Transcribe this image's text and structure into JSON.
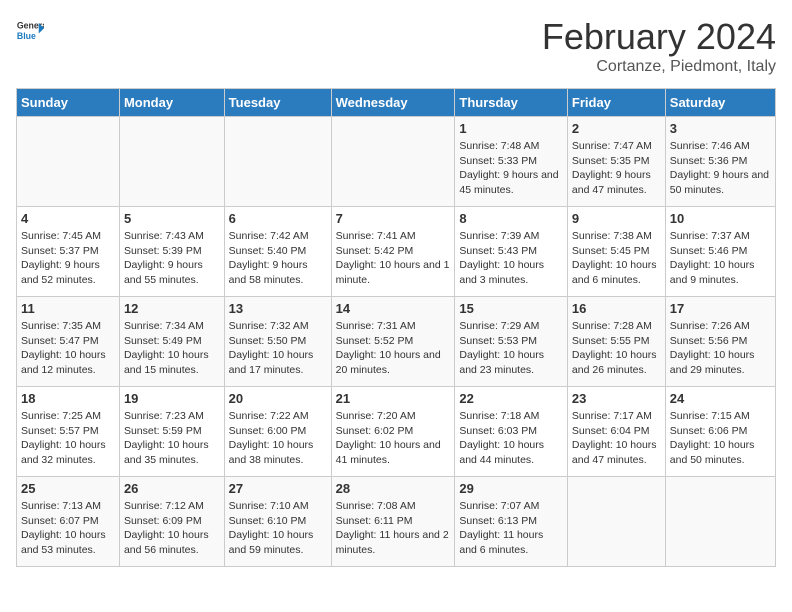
{
  "header": {
    "logo_line1": "General",
    "logo_line2": "Blue",
    "title": "February 2024",
    "subtitle": "Cortanze, Piedmont, Italy"
  },
  "columns": [
    "Sunday",
    "Monday",
    "Tuesday",
    "Wednesday",
    "Thursday",
    "Friday",
    "Saturday"
  ],
  "weeks": [
    {
      "days": [
        {
          "num": "",
          "info": ""
        },
        {
          "num": "",
          "info": ""
        },
        {
          "num": "",
          "info": ""
        },
        {
          "num": "",
          "info": ""
        },
        {
          "num": "1",
          "info": "Sunrise: 7:48 AM\nSunset: 5:33 PM\nDaylight: 9 hours\nand 45 minutes."
        },
        {
          "num": "2",
          "info": "Sunrise: 7:47 AM\nSunset: 5:35 PM\nDaylight: 9 hours\nand 47 minutes."
        },
        {
          "num": "3",
          "info": "Sunrise: 7:46 AM\nSunset: 5:36 PM\nDaylight: 9 hours\nand 50 minutes."
        }
      ]
    },
    {
      "days": [
        {
          "num": "4",
          "info": "Sunrise: 7:45 AM\nSunset: 5:37 PM\nDaylight: 9 hours\nand 52 minutes."
        },
        {
          "num": "5",
          "info": "Sunrise: 7:43 AM\nSunset: 5:39 PM\nDaylight: 9 hours\nand 55 minutes."
        },
        {
          "num": "6",
          "info": "Sunrise: 7:42 AM\nSunset: 5:40 PM\nDaylight: 9 hours\nand 58 minutes."
        },
        {
          "num": "7",
          "info": "Sunrise: 7:41 AM\nSunset: 5:42 PM\nDaylight: 10 hours\nand 1 minute."
        },
        {
          "num": "8",
          "info": "Sunrise: 7:39 AM\nSunset: 5:43 PM\nDaylight: 10 hours\nand 3 minutes."
        },
        {
          "num": "9",
          "info": "Sunrise: 7:38 AM\nSunset: 5:45 PM\nDaylight: 10 hours\nand 6 minutes."
        },
        {
          "num": "10",
          "info": "Sunrise: 7:37 AM\nSunset: 5:46 PM\nDaylight: 10 hours\nand 9 minutes."
        }
      ]
    },
    {
      "days": [
        {
          "num": "11",
          "info": "Sunrise: 7:35 AM\nSunset: 5:47 PM\nDaylight: 10 hours\nand 12 minutes."
        },
        {
          "num": "12",
          "info": "Sunrise: 7:34 AM\nSunset: 5:49 PM\nDaylight: 10 hours\nand 15 minutes."
        },
        {
          "num": "13",
          "info": "Sunrise: 7:32 AM\nSunset: 5:50 PM\nDaylight: 10 hours\nand 17 minutes."
        },
        {
          "num": "14",
          "info": "Sunrise: 7:31 AM\nSunset: 5:52 PM\nDaylight: 10 hours\nand 20 minutes."
        },
        {
          "num": "15",
          "info": "Sunrise: 7:29 AM\nSunset: 5:53 PM\nDaylight: 10 hours\nand 23 minutes."
        },
        {
          "num": "16",
          "info": "Sunrise: 7:28 AM\nSunset: 5:55 PM\nDaylight: 10 hours\nand 26 minutes."
        },
        {
          "num": "17",
          "info": "Sunrise: 7:26 AM\nSunset: 5:56 PM\nDaylight: 10 hours\nand 29 minutes."
        }
      ]
    },
    {
      "days": [
        {
          "num": "18",
          "info": "Sunrise: 7:25 AM\nSunset: 5:57 PM\nDaylight: 10 hours\nand 32 minutes."
        },
        {
          "num": "19",
          "info": "Sunrise: 7:23 AM\nSunset: 5:59 PM\nDaylight: 10 hours\nand 35 minutes."
        },
        {
          "num": "20",
          "info": "Sunrise: 7:22 AM\nSunset: 6:00 PM\nDaylight: 10 hours\nand 38 minutes."
        },
        {
          "num": "21",
          "info": "Sunrise: 7:20 AM\nSunset: 6:02 PM\nDaylight: 10 hours\nand 41 minutes."
        },
        {
          "num": "22",
          "info": "Sunrise: 7:18 AM\nSunset: 6:03 PM\nDaylight: 10 hours\nand 44 minutes."
        },
        {
          "num": "23",
          "info": "Sunrise: 7:17 AM\nSunset: 6:04 PM\nDaylight: 10 hours\nand 47 minutes."
        },
        {
          "num": "24",
          "info": "Sunrise: 7:15 AM\nSunset: 6:06 PM\nDaylight: 10 hours\nand 50 minutes."
        }
      ]
    },
    {
      "days": [
        {
          "num": "25",
          "info": "Sunrise: 7:13 AM\nSunset: 6:07 PM\nDaylight: 10 hours\nand 53 minutes."
        },
        {
          "num": "26",
          "info": "Sunrise: 7:12 AM\nSunset: 6:09 PM\nDaylight: 10 hours\nand 56 minutes."
        },
        {
          "num": "27",
          "info": "Sunrise: 7:10 AM\nSunset: 6:10 PM\nDaylight: 10 hours\nand 59 minutes."
        },
        {
          "num": "28",
          "info": "Sunrise: 7:08 AM\nSunset: 6:11 PM\nDaylight: 11 hours\nand 2 minutes."
        },
        {
          "num": "29",
          "info": "Sunrise: 7:07 AM\nSunset: 6:13 PM\nDaylight: 11 hours\nand 6 minutes."
        },
        {
          "num": "",
          "info": ""
        },
        {
          "num": "",
          "info": ""
        }
      ]
    }
  ]
}
